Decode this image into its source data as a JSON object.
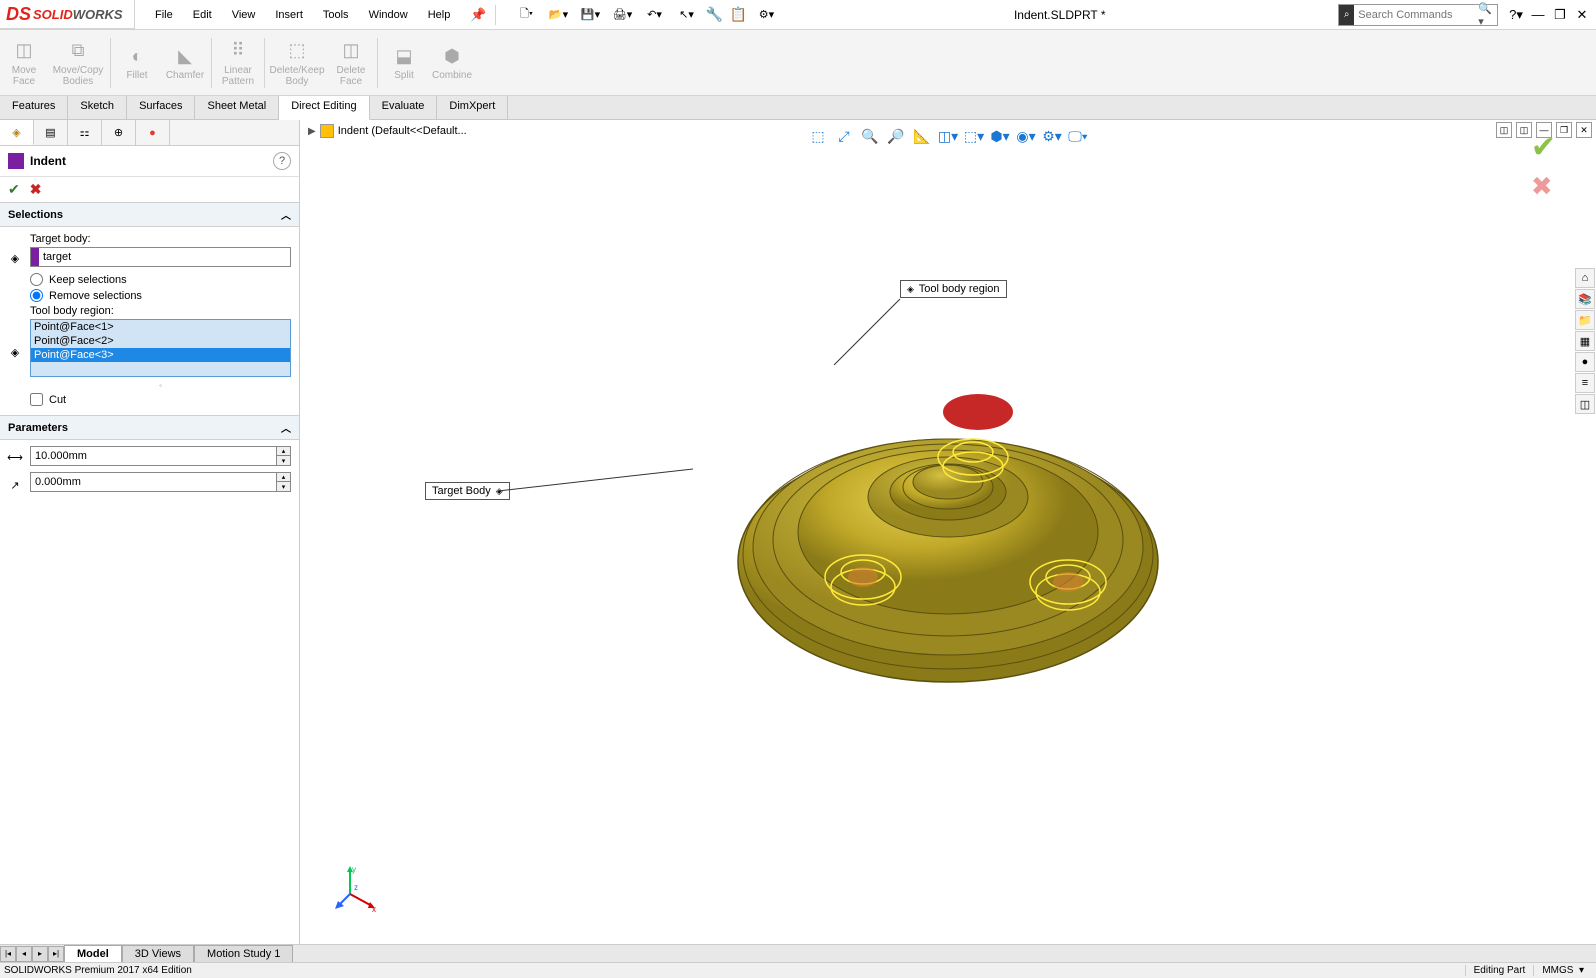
{
  "app": {
    "brand1": "SOLID",
    "brand2": "WORKS"
  },
  "menus": [
    "File",
    "Edit",
    "View",
    "Insert",
    "Tools",
    "Window",
    "Help"
  ],
  "document_title": "Indent.SLDPRT *",
  "search_placeholder": "Search Commands",
  "ribbon": [
    {
      "label": "Move Face"
    },
    {
      "label": "Move/Copy Bodies"
    },
    {
      "label": "Fillet"
    },
    {
      "label": "Chamfer"
    },
    {
      "label": "Linear Pattern"
    },
    {
      "label": "Delete/Keep Body"
    },
    {
      "label": "Delete Face"
    },
    {
      "label": "Split"
    },
    {
      "label": "Combine"
    }
  ],
  "command_tabs": [
    "Features",
    "Sketch",
    "Surfaces",
    "Sheet Metal",
    "Direct Editing",
    "Evaluate",
    "DimXpert"
  ],
  "command_tab_active": "Direct Editing",
  "breadcrumb": "Indent  (Default<<Default...",
  "prop": {
    "feature_name": "Indent",
    "sections": {
      "selections": {
        "title": "Selections",
        "target_body_label": "Target body:",
        "target_body_value": "target",
        "keep_label": "Keep selections",
        "remove_label": "Remove selections",
        "tool_region_label": "Tool body region:",
        "tool_items": [
          "Point@Face<1>",
          "Point@Face<2>",
          "Point@Face<3>"
        ],
        "cut_label": "Cut"
      },
      "parameters": {
        "title": "Parameters",
        "value1": "10.000mm",
        "value2": "0.000mm"
      }
    }
  },
  "callouts": {
    "tool": "Tool body region",
    "target": "Target Body"
  },
  "bottom_tabs": [
    "Model",
    "3D Views",
    "Motion Study 1"
  ],
  "bottom_tab_active": "Model",
  "status": {
    "left": "SOLIDWORKS Premium 2017 x64 Edition",
    "mode": "Editing Part",
    "units": "MMGS"
  }
}
